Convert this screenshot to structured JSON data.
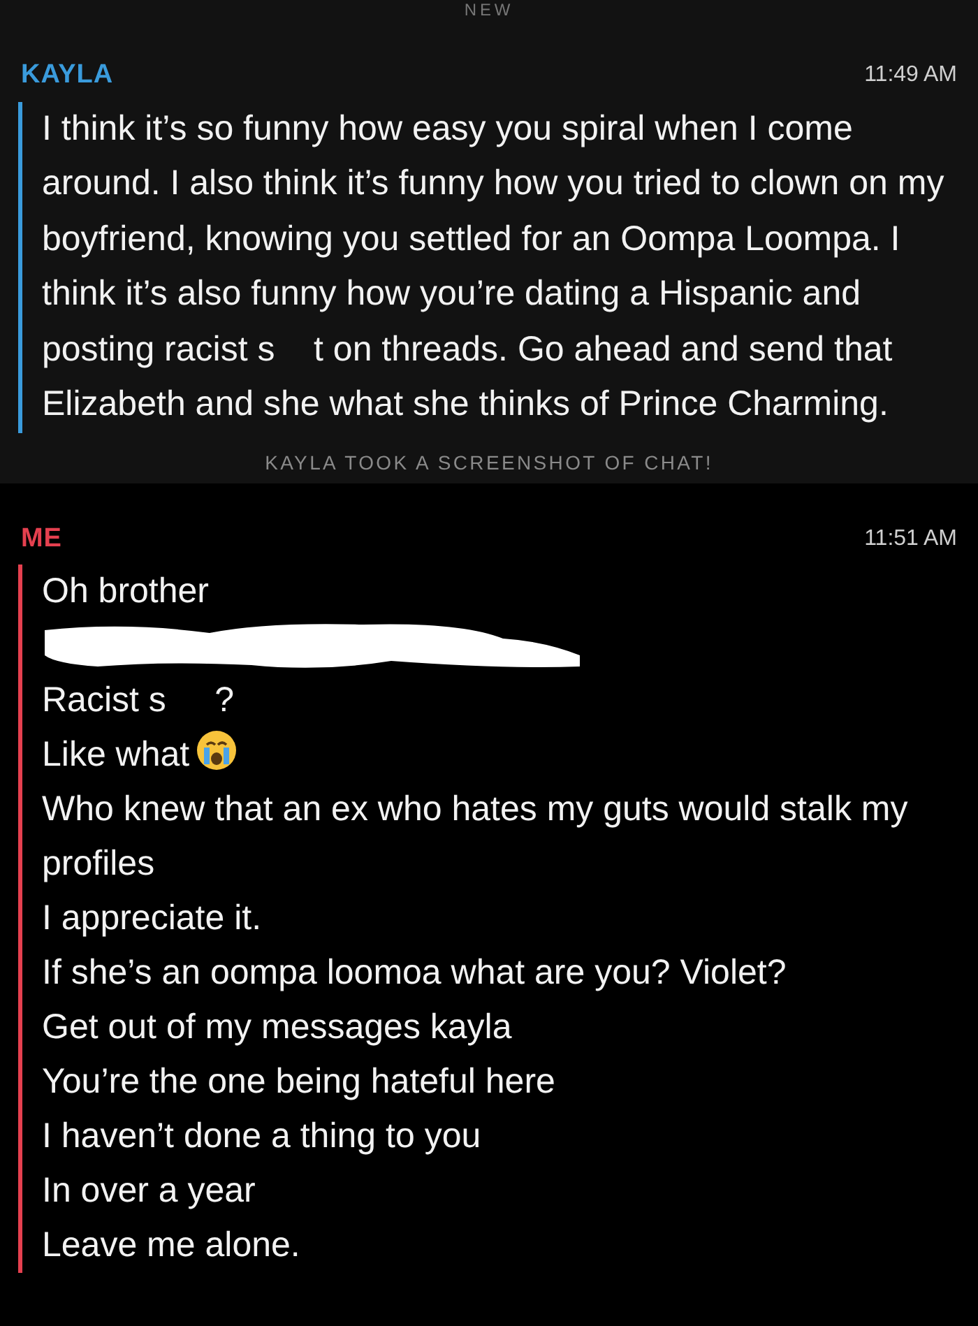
{
  "divider": "NEW",
  "messages": [
    {
      "sender": "KAYLA",
      "time": "11:49 AM",
      "color": "#3a9bdc",
      "paragraph": "I think it’s so funny how easy you spiral when I come around. I also think it’s funny how you tried to clown on my boyfriend, knowing you settled for an Oompa Loompa. I think it’s also funny how you’re dating a Hispanic and posting racist s    t on threads. Go ahead and send that Elizabeth and she what she thinks of Prince Charming.",
      "notice": "KAYLA TOOK A SCREENSHOT OF CHAT!"
    },
    {
      "sender": "ME",
      "time": "11:51 AM",
      "color": "#e5404f",
      "lines": [
        {
          "kind": "text",
          "text": "Oh brother"
        },
        {
          "kind": "redacted"
        },
        {
          "kind": "text",
          "text": "Racist s     ?"
        },
        {
          "kind": "emoji",
          "text": "Like what"
        },
        {
          "kind": "text",
          "text": "Who knew that an ex who hates my guts would stalk my profiles"
        },
        {
          "kind": "text",
          "text": "I appreciate it."
        },
        {
          "kind": "text",
          "text": "If she’s an oompa loomoa what are you? Violet?"
        },
        {
          "kind": "text",
          "text": "Get out of my messages kayla"
        },
        {
          "kind": "text",
          "text": "You’re the one being hateful here"
        },
        {
          "kind": "text",
          "text": "I haven’t done a thing to you"
        },
        {
          "kind": "text",
          "text": "In over a year"
        },
        {
          "kind": "text",
          "text": "Leave me alone."
        }
      ]
    }
  ]
}
